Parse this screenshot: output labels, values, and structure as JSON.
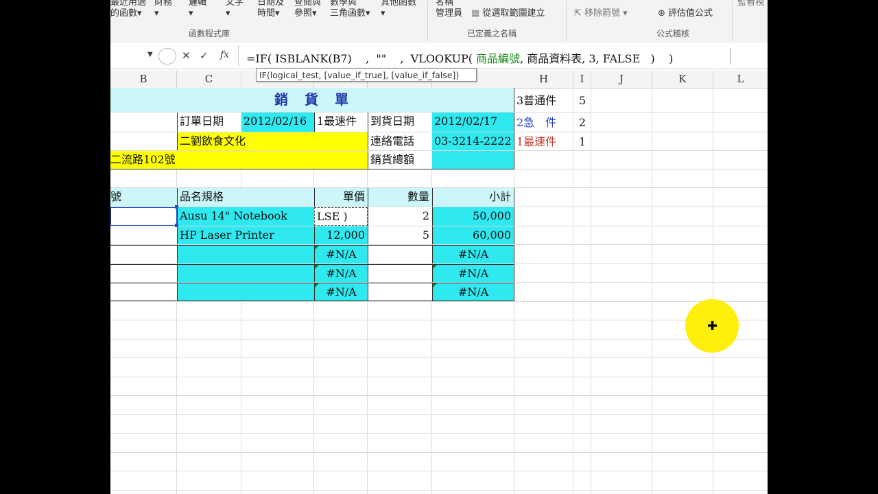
{
  "ribbon": {
    "buttons": [
      {
        "label": "最近用過\n的函數▾"
      },
      {
        "label": "財務\n▾"
      },
      {
        "label": "邏輯\n▾"
      },
      {
        "label": "文字\n▾"
      },
      {
        "label": "日期及\n時間▾"
      },
      {
        "label": "查閱與\n參照▾"
      },
      {
        "label": "數學與\n三角函數▾"
      },
      {
        "label": "其他函數\n▾"
      },
      {
        "label": "名稱\n管理員"
      },
      {
        "label": "從選取範圍建立"
      },
      {
        "label": "移除箭號 ▾"
      },
      {
        "label": "評估值公式"
      },
      {
        "label": "監看視"
      }
    ],
    "groups": {
      "function_library": "函數程式庫",
      "defined_names": "已定義之名稱",
      "formula_auditing": "公式稽核"
    }
  },
  "formula_bar": {
    "cancel": "✕",
    "enter": "✓",
    "fx": "fx",
    "formula_part1": "=IF( ISBLANK(B7)    ,  \"\"    ,  VLOOKUP( ",
    "formula_name1": "商品編號",
    "formula_part2": ", 商品資料表, 3, FALSE   )    )",
    "tooltip": "IF(logical_test, [value_if_true], [value_if_false])"
  },
  "columns": [
    "B",
    "C",
    "",
    "",
    "",
    "H",
    "I",
    "J",
    "K",
    "L"
  ],
  "sheet": {
    "title": "銷　貨　單",
    "order_date_label": "訂單日期",
    "order_date": "2012/02/16",
    "ship_type": "1最速件",
    "arrival_date_label": "到貨日期",
    "arrival_date": "2012/02/17",
    "customer": "二劉飲食文化",
    "phone_label": "連絡電話",
    "phone": "03-3214-2222",
    "address": "二流路102號",
    "total_label": "銷貨總額",
    "headers": {
      "id": "號",
      "name": "品名規格",
      "price": "單價",
      "qty": "數量",
      "subtotal": "小計"
    },
    "rows": [
      {
        "name": "Ausu 14\" Notebook",
        "price": "LSE   )",
        "qty": "2",
        "subtotal": "50,000"
      },
      {
        "name": "HP Laser Printer",
        "price": "12,000",
        "qty": "5",
        "subtotal": "60,000"
      },
      {
        "name": "",
        "price": "#N/A",
        "qty": "",
        "subtotal": "#N/A"
      },
      {
        "name": "",
        "price": "#N/A",
        "qty": "",
        "subtotal": "#N/A"
      },
      {
        "name": "",
        "price": "#N/A",
        "qty": "",
        "subtotal": "#N/A"
      }
    ],
    "lookup": [
      {
        "label": "3普通件",
        "value": "5",
        "color": "#000000"
      },
      {
        "label": "2急　件",
        "value": "2",
        "color": "#1f3fbf"
      },
      {
        "label": "1最速件",
        "value": "1",
        "color": "#c0392b"
      }
    ]
  },
  "colors": {
    "cyan": "#2ee9f0",
    "light_cyan": "#cdf6fa",
    "yellow": "#ffff00",
    "title_blue": "#1a3aa8"
  }
}
